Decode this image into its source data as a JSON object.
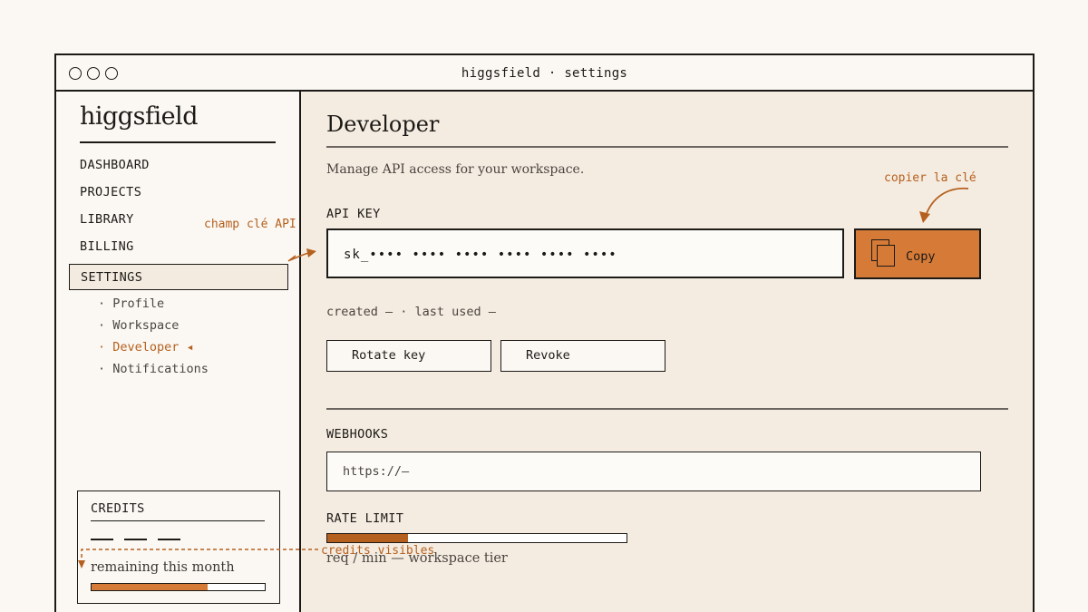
{
  "window": {
    "title": "higgsfield · settings"
  },
  "sidebar": {
    "brand": "higgsfield",
    "nav": [
      "DASHBOARD",
      "PROJECTS",
      "LIBRARY",
      "BILLING"
    ],
    "active": "SETTINGS",
    "subnav": [
      {
        "label": "· Profile"
      },
      {
        "label": "· Workspace"
      },
      {
        "label": "· Developer ◂"
      },
      {
        "label": "· Notifications"
      }
    ],
    "credits": {
      "title": "CREDITS",
      "remaining_label": "remaining this month",
      "fill_fraction": 0.67
    }
  },
  "main": {
    "title": "Developer",
    "description": "Manage API access for your workspace.",
    "api_key": {
      "label": "API KEY",
      "value": "sk_•••• •••• •••• •••• •••• ••••",
      "copy_label": "Copy",
      "meta": "created — · last used —"
    },
    "buttons": {
      "rotate": "Rotate key",
      "revoke": "Revoke"
    },
    "webhooks": {
      "label": "WEBHOOKS",
      "value": "https://—"
    },
    "rate_limit": {
      "label": "RATE LIMIT",
      "fill_fraction": 0.27,
      "caption": "req / min — workspace tier"
    }
  },
  "annotations": {
    "api_field": "champ clé API",
    "copy_key": "copier la clé",
    "credits": "credits visibles"
  },
  "colors": {
    "accent": "#d67a38",
    "accent_dark": "#b5601f",
    "ink": "#1c1a17",
    "panel": "#f5ece1",
    "paper": "#fbf8f3"
  }
}
